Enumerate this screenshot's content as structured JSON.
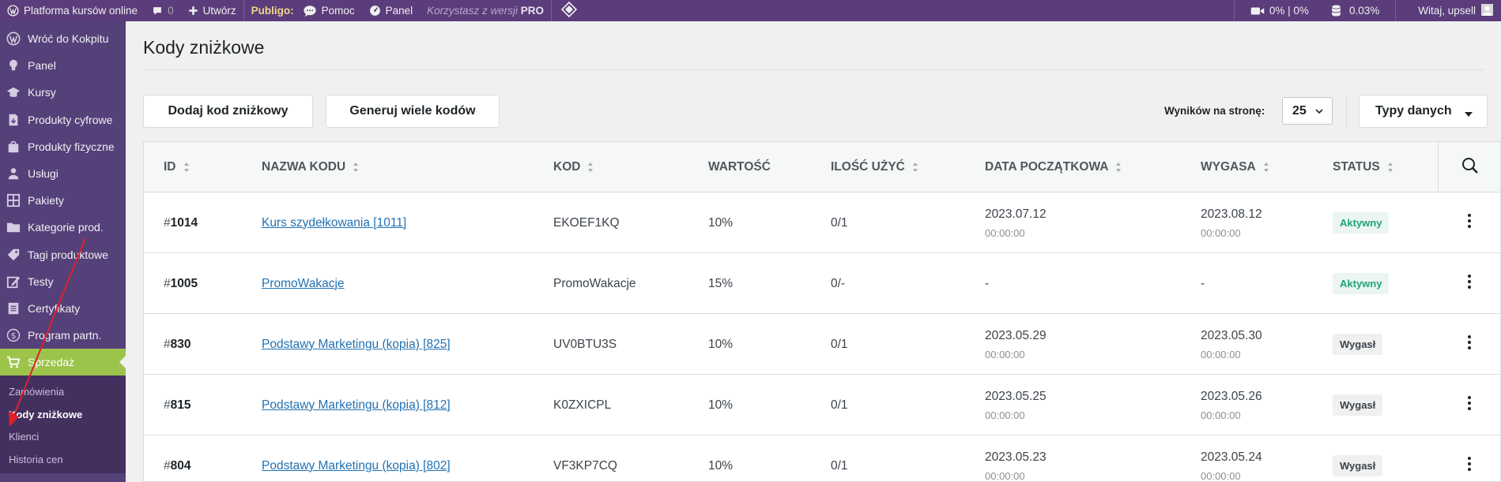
{
  "adminbar": {
    "site_name": "Platforma kursów online",
    "comments_count": "0",
    "create_label": "Utwórz",
    "brand_label": "Publigo:",
    "help_label": "Pomoc",
    "panel_label": "Panel",
    "pro_prefix": "Korzystasz z wersji",
    "pro_label": "PRO",
    "stat1": "0% | 0%",
    "stat2": "0.03%",
    "greeting": "Witaj, upsell"
  },
  "sidebar": {
    "items": [
      {
        "label": "Wróć do Kokpitu",
        "icon": "wordpress-icon"
      },
      {
        "label": "Panel",
        "icon": "lightbulb-icon"
      },
      {
        "label": "Kursy",
        "icon": "graduation-cap-icon"
      },
      {
        "label": "Produkty cyfrowe",
        "icon": "digital-product-icon"
      },
      {
        "label": "Produkty fizyczne",
        "icon": "shopping-bag-icon"
      },
      {
        "label": "Usługi",
        "icon": "person-icon"
      },
      {
        "label": "Pakiety",
        "icon": "grid-icon"
      },
      {
        "label": "Kategorie prod.",
        "icon": "folder-icon"
      },
      {
        "label": "Tagi produktowe",
        "icon": "tag-icon"
      },
      {
        "label": "Testy",
        "icon": "edit-icon"
      },
      {
        "label": "Certyfikaty",
        "icon": "document-icon"
      },
      {
        "label": "Program partn.",
        "icon": "dollar-icon"
      },
      {
        "label": "Sprzedaż",
        "icon": "cart-icon"
      }
    ],
    "submenu": [
      "Zamówienia",
      "Kody zniżkowe",
      "Klienci",
      "Historia cen"
    ]
  },
  "page": {
    "title": "Kody zniżkowe",
    "add_button": "Dodaj kod zniżkowy",
    "generate_button": "Generuj wiele kodów",
    "per_page_label": "Wyników na stronę:",
    "per_page_value": "25",
    "data_types_button": "Typy danych"
  },
  "table": {
    "headers": [
      "ID",
      "NAZWA KODU",
      "KOD",
      "WARTOŚĆ",
      "ILOŚĆ UŻYĆ",
      "DATA POCZĄTKOWA",
      "WYGASA",
      "STATUS"
    ],
    "rows": [
      {
        "hash": "#",
        "id": "1014",
        "name": "Kurs szydełkowania [1011]",
        "code": "EKOEF1KQ",
        "value": "10%",
        "uses": "0/1",
        "start_date": "2023.07.12",
        "start_time": "00:00:00",
        "end_date": "2023.08.12",
        "end_time": "00:00:00",
        "status": "Aktywny",
        "status_type": "active"
      },
      {
        "hash": "#",
        "id": "1005",
        "name": "PromoWakacje",
        "code": "PromoWakacje",
        "value": "15%",
        "uses": "0/-",
        "start_date": "-",
        "start_time": "",
        "end_date": "-",
        "end_time": "",
        "status": "Aktywny",
        "status_type": "active"
      },
      {
        "hash": "#",
        "id": "830",
        "name": "Podstawy Marketingu (kopia) [825]",
        "code": "UV0BTU3S",
        "value": "10%",
        "uses": "0/1",
        "start_date": "2023.05.29",
        "start_time": "00:00:00",
        "end_date": "2023.05.30",
        "end_time": "00:00:00",
        "status": "Wygasł",
        "status_type": "expired"
      },
      {
        "hash": "#",
        "id": "815",
        "name": "Podstawy Marketingu (kopia) [812]",
        "code": "K0ZXICPL",
        "value": "10%",
        "uses": "0/1",
        "start_date": "2023.05.25",
        "start_time": "00:00:00",
        "end_date": "2023.05.26",
        "end_time": "00:00:00",
        "status": "Wygasł",
        "status_type": "expired"
      },
      {
        "hash": "#",
        "id": "804",
        "name": "Podstawy Marketingu (kopia) [802]",
        "code": "VF3KP7CQ",
        "value": "10%",
        "uses": "0/1",
        "start_date": "2023.05.23",
        "start_time": "00:00:00",
        "end_date": "2023.05.24",
        "end_time": "00:00:00",
        "status": "Wygasł",
        "status_type": "expired"
      }
    ]
  },
  "colors": {
    "adminbar": "#5a3d7a",
    "sidebar": "#55407a",
    "sidebar_active": "#9cc44b",
    "link": "#2271b1",
    "badge_active": "#1fa37a",
    "annotation_arrow": "#e0202a"
  }
}
